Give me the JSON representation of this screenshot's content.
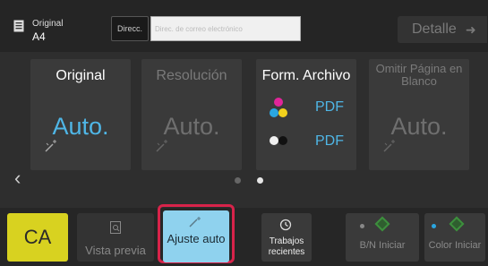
{
  "header": {
    "original_label": "Original",
    "original_size": "A4",
    "direcc_label": "Direcc.",
    "email_placeholder": "Direc. de correo electrónico",
    "detalle_label": "Detalle"
  },
  "tiles": [
    {
      "title": "Original",
      "value": "Auto.",
      "enabled": true
    },
    {
      "title": "Resolución",
      "value": "Auto.",
      "enabled": false
    },
    {
      "title": "Form. Archivo",
      "values": [
        "PDF",
        "PDF"
      ],
      "enabled": true
    },
    {
      "title": "Omitir Página en Blanco",
      "value": "Auto.",
      "enabled": false
    }
  ],
  "pager": {
    "current_page": 2,
    "total_pages": 2
  },
  "footer": {
    "ca_label": "CA",
    "preview_label": "Vista previa",
    "ajuste_label": "Ajuste auto",
    "recent_label": "Trabajos recientes",
    "bn_label": "B/N Iniciar",
    "color_label": "Color Iniciar"
  },
  "colors": {
    "accent_blue": "#4fb6e6",
    "ca_yellow": "#d8d220",
    "highlight_red": "#d8234a",
    "ajuste_bg": "#8fd2ee"
  },
  "icons": {
    "original": "document-icon",
    "detalle": "arrow-right-icon",
    "wand": "magic-wand-icon",
    "preview": "magnifier-document-icon",
    "recent": "history-clock-icon",
    "start": "start-diamond-icon"
  }
}
